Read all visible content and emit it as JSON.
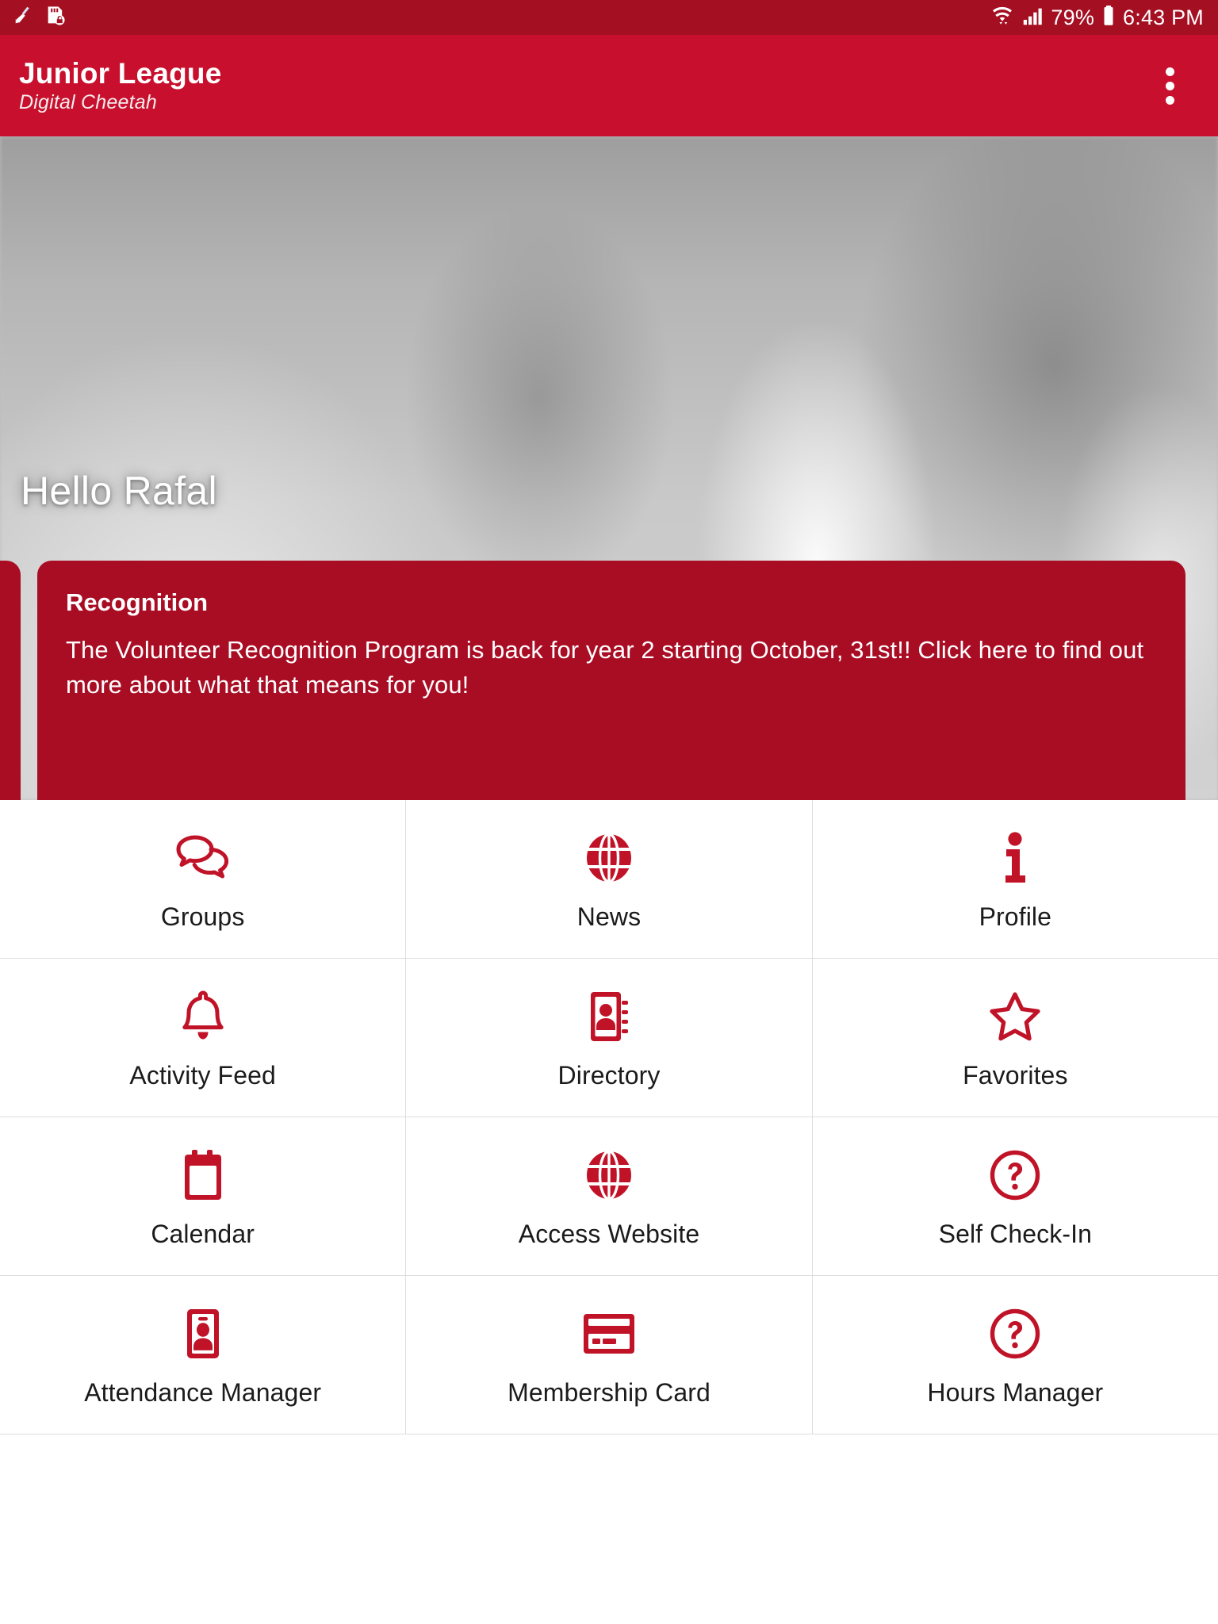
{
  "colors": {
    "status_bar": "#a50f22",
    "app_bar": "#c8102e",
    "card": "#a90d24",
    "icon": "#c01328",
    "label": "#1b1b1b",
    "divider": "#dedede"
  },
  "status_bar": {
    "left_icons": [
      {
        "name": "broom-cleaner-icon",
        "glyph": "broom"
      },
      {
        "name": "secure-storage-lock-icon",
        "glyph": "sd-card-lock"
      }
    ],
    "wifi_icon": "wifi-icon",
    "signal_icon": "cellular-signal-icon",
    "battery_percent": "79%",
    "battery_icon": "battery-icon",
    "time": "6:43 PM"
  },
  "app_bar": {
    "title": "Junior League",
    "subtitle": "Digital Cheetah",
    "overflow_icon": "overflow-menu-icon"
  },
  "hero": {
    "greeting": "Hello Rafal",
    "carousel": {
      "card": {
        "title": "Recognition",
        "body": "The Volunteer Recognition Program is back for year 2 starting October, 31st!! Click here to find out more about what that means for you!"
      },
      "dots": [
        {
          "active": false
        },
        {
          "active": false
        },
        {
          "active": true
        }
      ],
      "active_index": 2,
      "total": 3
    }
  },
  "menu": {
    "rows": [
      [
        {
          "label": "Groups",
          "icon": "chat-bubbles-icon"
        },
        {
          "label": "News",
          "icon": "globe-icon"
        },
        {
          "label": "Profile",
          "icon": "info-icon"
        }
      ],
      [
        {
          "label": "Activity Feed",
          "icon": "bell-icon"
        },
        {
          "label": "Directory",
          "icon": "address-book-icon"
        },
        {
          "label": "Favorites",
          "icon": "star-icon"
        }
      ],
      [
        {
          "label": "Calendar",
          "icon": "calendar-icon"
        },
        {
          "label": "Access Website",
          "icon": "globe-icon"
        },
        {
          "label": "Self Check-In",
          "icon": "question-circle-icon"
        }
      ],
      [
        {
          "label": "Attendance Manager",
          "icon": "id-badge-icon"
        },
        {
          "label": "Membership Card",
          "icon": "credit-card-icon"
        },
        {
          "label": "Hours Manager",
          "icon": "question-circle-icon"
        }
      ]
    ]
  }
}
